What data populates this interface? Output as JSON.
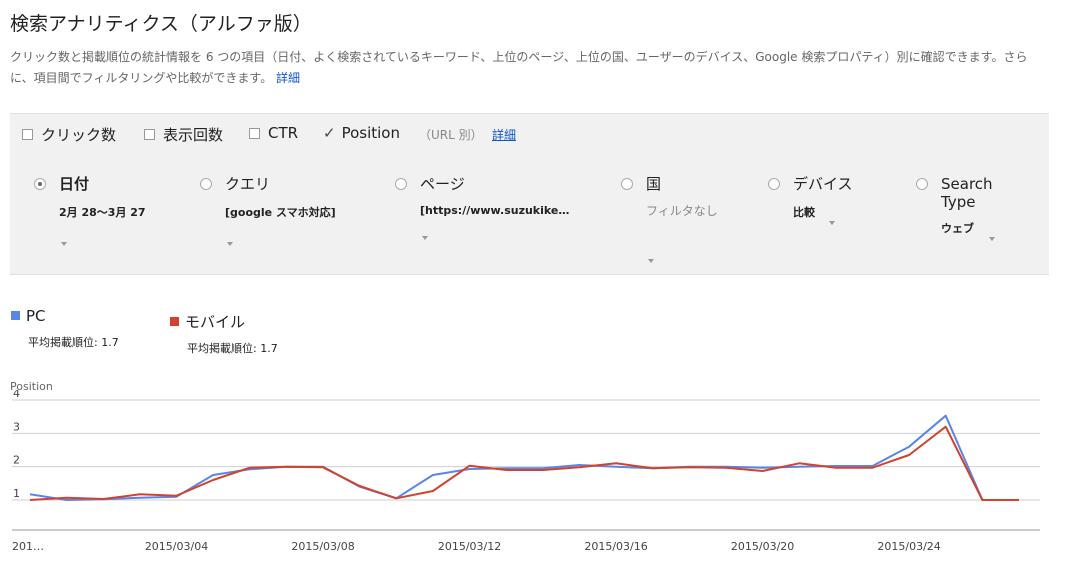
{
  "header": {
    "title": "検索アナリティクス（アルファ版）",
    "description": "クリック数と掲載順位の統計情報を 6 つの項目（日付、よく検索されているキーワード、上位のページ、上位の国、ユーザーのデバイス、Google 検索プロパティ）別に確認できます。さらに、項目間でフィルタリングや比較ができます。",
    "details_link": "詳細"
  },
  "metrics": [
    {
      "label": "クリック数",
      "checked": false
    },
    {
      "label": "表示回数",
      "checked": false
    },
    {
      "label": "CTR",
      "checked": false
    },
    {
      "label": "Position",
      "checked": true
    }
  ],
  "metrics_note": "（URL 別）",
  "metrics_link": "詳細",
  "dimensions": [
    {
      "label": "日付",
      "value": "2月 28〜3月 27",
      "selected": true
    },
    {
      "label": "クエリ",
      "value": "[google スマホ対応]",
      "selected": false
    },
    {
      "label": "ページ",
      "value": "[https://www.suzukike…",
      "selected": false
    },
    {
      "label": "国",
      "value": "フィルタなし",
      "selected": false
    },
    {
      "label": "デバイス",
      "value": "比較",
      "selected": false
    },
    {
      "label": "Search Type",
      "value": "ウェブ",
      "selected": false
    }
  ],
  "legend": [
    {
      "name": "PC",
      "sub": "平均掲載順位: 1.7",
      "color": "#5b84e8"
    },
    {
      "name": "モバイル",
      "sub": "平均掲載順位: 1.7",
      "color": "#d0432d"
    }
  ],
  "chart_data": {
    "type": "line",
    "ylabel": "Position",
    "ylim": [
      0.85,
      4
    ],
    "yticks": [
      1,
      2,
      3,
      4
    ],
    "x": [
      "2015/02/28",
      "2015/03/01",
      "2015/03/02",
      "2015/03/03",
      "2015/03/04",
      "2015/03/05",
      "2015/03/06",
      "2015/03/07",
      "2015/03/08",
      "2015/03/09",
      "2015/03/10",
      "2015/03/11",
      "2015/03/12",
      "2015/03/13",
      "2015/03/14",
      "2015/03/15",
      "2015/03/16",
      "2015/03/17",
      "2015/03/18",
      "2015/03/19",
      "2015/03/20",
      "2015/03/21",
      "2015/03/22",
      "2015/03/23",
      "2015/03/24",
      "2015/03/25",
      "2015/03/26",
      "2015/03/27"
    ],
    "xtick_labels": [
      {
        "index": 0,
        "label": "201…"
      },
      {
        "index": 4,
        "label": "2015/03/04"
      },
      {
        "index": 8,
        "label": "2015/03/08"
      },
      {
        "index": 12,
        "label": "2015/03/12"
      },
      {
        "index": 16,
        "label": "2015/03/16"
      },
      {
        "index": 20,
        "label": "2015/03/20"
      },
      {
        "index": 24,
        "label": "2015/03/24"
      }
    ],
    "series": [
      {
        "name": "PC",
        "color": "#5b84e8",
        "values": [
          1.17,
          1.0,
          1.02,
          1.07,
          1.1,
          1.75,
          1.92,
          2.0,
          2.0,
          1.4,
          1.05,
          1.75,
          1.93,
          1.95,
          1.95,
          2.05,
          2.0,
          1.95,
          2.0,
          2.0,
          1.97,
          2.0,
          2.02,
          2.02,
          2.6,
          3.53,
          1.0,
          1.0
        ]
      },
      {
        "name": "モバイル",
        "color": "#d0432d",
        "values": [
          1.0,
          1.07,
          1.03,
          1.17,
          1.13,
          1.6,
          1.97,
          2.0,
          1.98,
          1.42,
          1.05,
          1.27,
          2.03,
          1.9,
          1.9,
          1.98,
          2.1,
          1.95,
          1.98,
          1.97,
          1.87,
          2.1,
          1.97,
          1.97,
          2.35,
          3.2,
          1.0,
          1.0
        ]
      }
    ]
  }
}
